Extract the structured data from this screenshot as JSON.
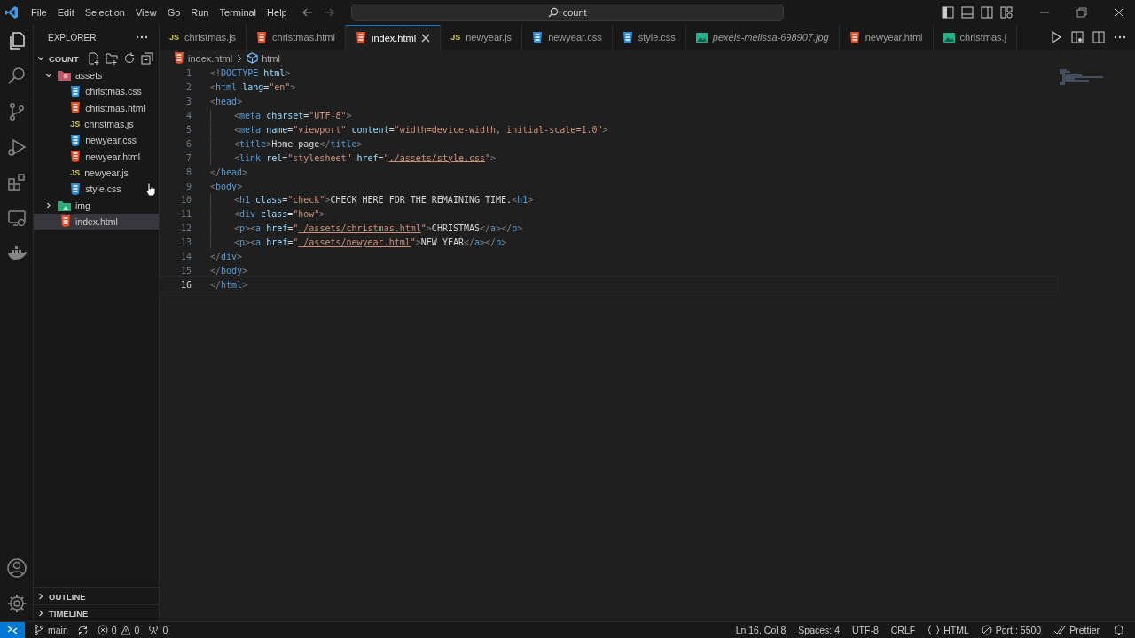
{
  "menu": [
    "File",
    "Edit",
    "Selection",
    "View",
    "Go",
    "Run",
    "Terminal",
    "Help"
  ],
  "command_center": {
    "value": "count"
  },
  "sidebar": {
    "title": "EXPLORER",
    "folder": {
      "label": "COUNT",
      "expanded": true
    },
    "tree": [
      {
        "label": "assets",
        "kind": "folder",
        "expanded": true,
        "selected": false,
        "children": [
          {
            "label": "christmas.css",
            "kind": "css",
            "selected": false
          },
          {
            "label": "christmas.html",
            "kind": "html",
            "selected": false
          },
          {
            "label": "christmas.js",
            "kind": "js",
            "badge": "JS",
            "selected": false
          },
          {
            "label": "newyear.css",
            "kind": "css",
            "selected": false
          },
          {
            "label": "newyear.html",
            "kind": "html",
            "selected": false
          },
          {
            "label": "newyear.js",
            "kind": "js",
            "badge": "JS",
            "selected": false
          },
          {
            "label": "style.css",
            "kind": "css",
            "selected": false
          }
        ]
      },
      {
        "label": "img",
        "kind": "imgfolder",
        "expanded": false,
        "selected": false
      },
      {
        "label": "index.html",
        "kind": "html",
        "selected": true
      }
    ],
    "sections": [
      {
        "label": "OUTLINE",
        "expanded": false
      },
      {
        "label": "TIMELINE",
        "expanded": false
      }
    ]
  },
  "tabs": [
    {
      "label": "christmas.js",
      "kind": "js",
      "badge": "JS",
      "selected": false,
      "preview": false
    },
    {
      "label": "christmas.html",
      "kind": "html",
      "selected": false,
      "preview": false
    },
    {
      "label": "index.html",
      "kind": "html",
      "selected": true,
      "preview": false
    },
    {
      "label": "newyear.js",
      "kind": "js",
      "badge": "JS",
      "selected": false,
      "preview": false
    },
    {
      "label": "newyear.css",
      "kind": "css",
      "selected": false,
      "preview": false
    },
    {
      "label": "style.css",
      "kind": "css",
      "selected": false,
      "preview": false
    },
    {
      "label": "pexels-melissa-698907.jpg",
      "kind": "image",
      "selected": false,
      "preview": true
    },
    {
      "label": "newyear.html",
      "kind": "html",
      "selected": false,
      "preview": false
    },
    {
      "label": "christmas.j",
      "kind": "image",
      "selected": false,
      "preview": false
    }
  ],
  "breadcrumb": [
    {
      "label": "index.html",
      "kind": "html"
    },
    {
      "label": "html",
      "kind": "element"
    }
  ],
  "editor": {
    "lines": [
      {
        "number": "1",
        "current": false,
        "indented": false,
        "tokens": [
          {
            "kind": "bracket",
            "text": "<!"
          },
          {
            "kind": "tag",
            "text": "DOCTYPE"
          },
          {
            "kind": "attr",
            "text": " html"
          },
          {
            "kind": "bracket",
            "text": ">"
          }
        ]
      },
      {
        "number": "2",
        "current": false,
        "indented": false,
        "tokens": [
          {
            "kind": "bracket",
            "text": "<"
          },
          {
            "kind": "tag",
            "text": "html"
          },
          {
            "kind": "attr",
            "text": " lang"
          },
          {
            "kind": "text",
            "text": "="
          },
          {
            "kind": "string",
            "text": "\"en\""
          },
          {
            "kind": "bracket",
            "text": ">"
          }
        ]
      },
      {
        "number": "3",
        "current": false,
        "indented": false,
        "tokens": [
          {
            "kind": "bracket",
            "text": "<"
          },
          {
            "kind": "tag",
            "text": "head"
          },
          {
            "kind": "bracket",
            "text": ">"
          }
        ]
      },
      {
        "number": "4",
        "current": false,
        "indented": true,
        "tokens": [
          {
            "kind": "bracket",
            "text": "<"
          },
          {
            "kind": "tag",
            "text": "meta"
          },
          {
            "kind": "attr",
            "text": " charset"
          },
          {
            "kind": "text",
            "text": "="
          },
          {
            "kind": "string",
            "text": "\"UTF-8\""
          },
          {
            "kind": "bracket",
            "text": ">"
          }
        ]
      },
      {
        "number": "5",
        "current": false,
        "indented": true,
        "tokens": [
          {
            "kind": "bracket",
            "text": "<"
          },
          {
            "kind": "tag",
            "text": "meta"
          },
          {
            "kind": "attr",
            "text": " name"
          },
          {
            "kind": "text",
            "text": "="
          },
          {
            "kind": "string",
            "text": "\"viewport\""
          },
          {
            "kind": "attr",
            "text": " content"
          },
          {
            "kind": "text",
            "text": "="
          },
          {
            "kind": "string",
            "text": "\"width=device-width, initial-scale=1.0\""
          },
          {
            "kind": "bracket",
            "text": ">"
          }
        ]
      },
      {
        "number": "6",
        "current": false,
        "indented": true,
        "tokens": [
          {
            "kind": "bracket",
            "text": "<"
          },
          {
            "kind": "tag",
            "text": "title"
          },
          {
            "kind": "bracket",
            "text": ">"
          },
          {
            "kind": "text",
            "text": "Home page"
          },
          {
            "kind": "bracket",
            "text": "</"
          },
          {
            "kind": "tag",
            "text": "title"
          },
          {
            "kind": "bracket",
            "text": ">"
          }
        ]
      },
      {
        "number": "7",
        "current": false,
        "indented": true,
        "tokens": [
          {
            "kind": "bracket",
            "text": "<"
          },
          {
            "kind": "tag",
            "text": "link"
          },
          {
            "kind": "attr",
            "text": " rel"
          },
          {
            "kind": "text",
            "text": "="
          },
          {
            "kind": "string",
            "text": "\"stylesheet\""
          },
          {
            "kind": "attr",
            "text": " href"
          },
          {
            "kind": "text",
            "text": "="
          },
          {
            "kind": "string",
            "text": "\""
          },
          {
            "kind": "link",
            "text": "./assets/style.css"
          },
          {
            "kind": "string",
            "text": "\""
          },
          {
            "kind": "bracket",
            "text": ">"
          }
        ]
      },
      {
        "number": "8",
        "current": false,
        "indented": false,
        "tokens": [
          {
            "kind": "bracket",
            "text": "</"
          },
          {
            "kind": "tag",
            "text": "head"
          },
          {
            "kind": "bracket",
            "text": ">"
          }
        ]
      },
      {
        "number": "9",
        "current": false,
        "indented": false,
        "tokens": [
          {
            "kind": "bracket",
            "text": "<"
          },
          {
            "kind": "tag",
            "text": "body"
          },
          {
            "kind": "bracket",
            "text": ">"
          }
        ]
      },
      {
        "number": "10",
        "current": false,
        "indented": true,
        "tokens": [
          {
            "kind": "bracket",
            "text": "<"
          },
          {
            "kind": "tag",
            "text": "h1"
          },
          {
            "kind": "attr",
            "text": " class"
          },
          {
            "kind": "text",
            "text": "="
          },
          {
            "kind": "string",
            "text": "\"check\""
          },
          {
            "kind": "bracket",
            "text": ">"
          },
          {
            "kind": "text",
            "text": "CHECK HERE FOR THE REMAINING TIME."
          },
          {
            "kind": "bracket",
            "text": "<"
          },
          {
            "kind": "tag",
            "text": "h1"
          },
          {
            "kind": "bracket",
            "text": ">"
          }
        ]
      },
      {
        "number": "11",
        "current": false,
        "indented": true,
        "tokens": [
          {
            "kind": "bracket",
            "text": "<"
          },
          {
            "kind": "tag",
            "text": "div"
          },
          {
            "kind": "attr",
            "text": " class"
          },
          {
            "kind": "text",
            "text": "="
          },
          {
            "kind": "string",
            "text": "\"how\""
          },
          {
            "kind": "bracket",
            "text": ">"
          }
        ]
      },
      {
        "number": "12",
        "current": false,
        "indented": true,
        "tokens": [
          {
            "kind": "bracket",
            "text": "<"
          },
          {
            "kind": "tag",
            "text": "p"
          },
          {
            "kind": "bracket",
            "text": "><"
          },
          {
            "kind": "tag",
            "text": "a"
          },
          {
            "kind": "attr",
            "text": " href"
          },
          {
            "kind": "text",
            "text": "="
          },
          {
            "kind": "string",
            "text": "\""
          },
          {
            "kind": "link",
            "text": "./assets/christmas.html"
          },
          {
            "kind": "string",
            "text": "\""
          },
          {
            "kind": "bracket",
            "text": ">"
          },
          {
            "kind": "text",
            "text": "CHRISTMAS"
          },
          {
            "kind": "bracket",
            "text": "</"
          },
          {
            "kind": "tag",
            "text": "a"
          },
          {
            "kind": "bracket",
            "text": "></"
          },
          {
            "kind": "tag",
            "text": "p"
          },
          {
            "kind": "bracket",
            "text": ">"
          }
        ]
      },
      {
        "number": "13",
        "current": false,
        "indented": true,
        "tokens": [
          {
            "kind": "bracket",
            "text": "<"
          },
          {
            "kind": "tag",
            "text": "p"
          },
          {
            "kind": "bracket",
            "text": "><"
          },
          {
            "kind": "tag",
            "text": "a"
          },
          {
            "kind": "attr",
            "text": " href"
          },
          {
            "kind": "text",
            "text": "="
          },
          {
            "kind": "string",
            "text": "\""
          },
          {
            "kind": "link",
            "text": "./assets/newyear.html"
          },
          {
            "kind": "string",
            "text": "\""
          },
          {
            "kind": "bracket",
            "text": ">"
          },
          {
            "kind": "text",
            "text": "NEW YEAR"
          },
          {
            "kind": "bracket",
            "text": "</"
          },
          {
            "kind": "tag",
            "text": "a"
          },
          {
            "kind": "bracket",
            "text": "></"
          },
          {
            "kind": "tag",
            "text": "p"
          },
          {
            "kind": "bracket",
            "text": ">"
          }
        ]
      },
      {
        "number": "14",
        "current": false,
        "indented": false,
        "tokens": [
          {
            "kind": "bracket",
            "text": "</"
          },
          {
            "kind": "tag",
            "text": "div"
          },
          {
            "kind": "bracket",
            "text": ">"
          }
        ]
      },
      {
        "number": "15",
        "current": false,
        "indented": false,
        "tokens": [
          {
            "kind": "bracket",
            "text": "</"
          },
          {
            "kind": "tag",
            "text": "body"
          },
          {
            "kind": "bracket",
            "text": ">"
          }
        ]
      },
      {
        "number": "16",
        "current": true,
        "indented": false,
        "tokens": [
          {
            "kind": "bracket",
            "text": "</"
          },
          {
            "kind": "tag",
            "text": "html"
          },
          {
            "kind": "bracket",
            "text": ">"
          }
        ]
      }
    ]
  },
  "status_bar": {
    "branch": "main",
    "errors": "0",
    "warnings": "0",
    "ports": "0",
    "right": [
      {
        "label": "Ln 16, Col 8",
        "kind": "text"
      },
      {
        "label": "Spaces: 4",
        "kind": "text"
      },
      {
        "label": "UTF-8",
        "kind": "text"
      },
      {
        "label": "CRLF",
        "kind": "text"
      },
      {
        "label": "HTML",
        "kind": "language"
      },
      {
        "label": "Port : 5500",
        "kind": "port"
      },
      {
        "label": "Prettier",
        "kind": "prettier"
      }
    ]
  }
}
